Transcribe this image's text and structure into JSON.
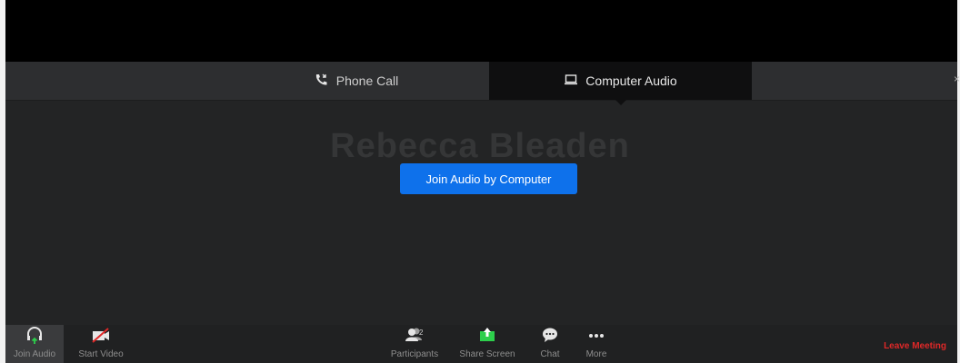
{
  "tabs": {
    "phone_label": "Phone Call",
    "computer_label": "Computer Audio",
    "close_glyph": "×"
  },
  "meeting": {
    "participant_name": "Rebecca Bleaden",
    "join_button_label": "Join Audio by Computer"
  },
  "toolbar": {
    "join_audio": "Join Audio",
    "start_video": "Start Video",
    "participants": "Participants",
    "participants_count": "2",
    "share_screen": "Share Screen",
    "chat": "Chat",
    "more": "More",
    "leave": "Leave Meeting"
  },
  "colors": {
    "accent": "#0e71eb",
    "leave": "#e02828",
    "share": "#2dcf4c"
  },
  "icons": {
    "phone": "phone-icon",
    "computer": "laptop-icon",
    "headphones": "headphones-icon",
    "video_off": "video-off-icon",
    "participants": "participants-icon",
    "share": "share-screen-icon",
    "chat": "chat-icon",
    "more": "more-icon"
  }
}
